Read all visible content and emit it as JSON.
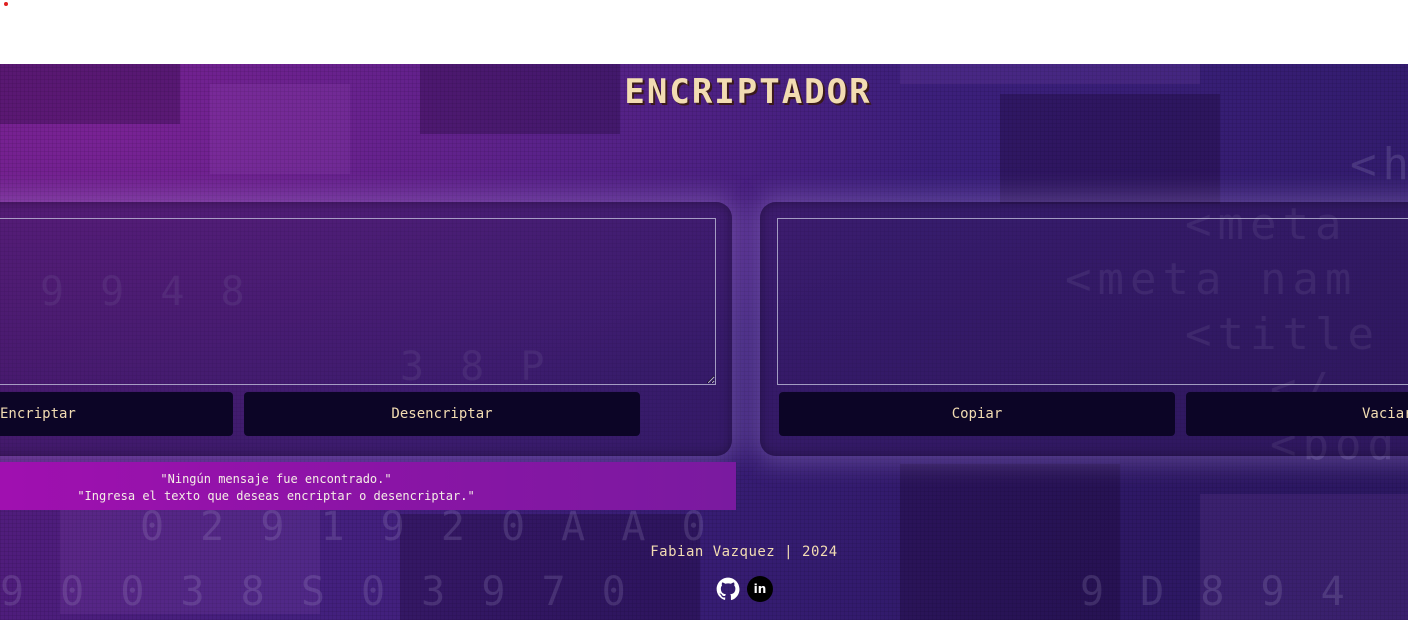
{
  "app": {
    "title": "ENCRIPTADOR"
  },
  "input": {
    "value": "",
    "placeholder": ""
  },
  "output": {
    "value": ""
  },
  "buttons": {
    "encrypt_label": "Encriptar",
    "decrypt_label": "Desencriptar",
    "copy_label": "Copiar",
    "clear_label": "Vaciar"
  },
  "message": {
    "line1": "\"Ningún mensaje fue encontrado.\"",
    "line2": "\"Ingresa el texto que deseas encriptar o desencriptar.\""
  },
  "footer": {
    "credit": "Fabian Vazquez | 2024",
    "links": [
      {
        "icon": "github-icon"
      },
      {
        "icon": "linkedin-icon",
        "glyph": "in"
      }
    ]
  },
  "colors": {
    "title": "#f2dcb2",
    "button_bg": "#0c0526",
    "button_text": "#f2dcb2",
    "message_bar": "#a010b0",
    "background_purple": "#44207e"
  }
}
